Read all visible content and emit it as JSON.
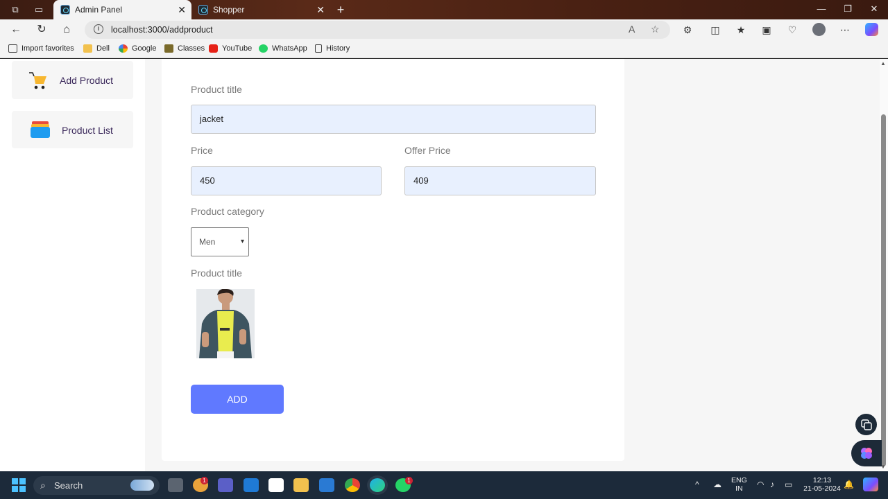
{
  "browser": {
    "tabs": [
      {
        "title": "Admin Panel",
        "active": true
      },
      {
        "title": "Shopper",
        "active": false
      }
    ],
    "url": "localhost:3000/addproduct",
    "bookmarks": [
      "Import favorites",
      "Dell",
      "Google",
      "Classes",
      "YouTube",
      "WhatsApp",
      "History"
    ]
  },
  "sidebar": {
    "items": [
      {
        "label": "Add Product",
        "icon": "cart-icon"
      },
      {
        "label": "Product List",
        "icon": "stack-icon"
      }
    ]
  },
  "form": {
    "title_label": "Product title",
    "title_value": "jacket",
    "price_label": "Price",
    "price_value": "450",
    "offer_label": "Offer Price",
    "offer_value": "409",
    "category_label": "Product category",
    "category_value": "Men",
    "image_label": "Product title",
    "add_label": "ADD"
  },
  "taskbar": {
    "search_label": "Search",
    "lang_top": "ENG",
    "lang_bottom": "IN",
    "time": "12:13",
    "date": "21-05-2024",
    "teams_badge": "1",
    "whatsapp_badge": "1"
  },
  "colors": {
    "accent": "#6079ff",
    "input_bg": "#e8f0fe",
    "sidebar_text": "#3c2a5c"
  }
}
